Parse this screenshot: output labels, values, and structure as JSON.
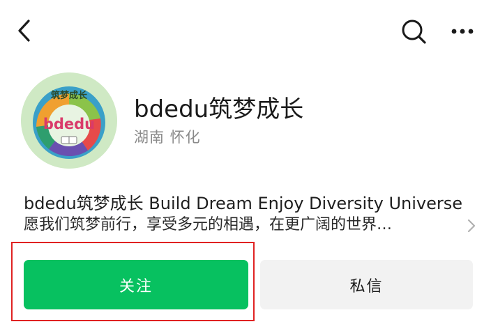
{
  "header": {
    "back_icon": "chevron-left-icon",
    "search_icon": "search-icon",
    "more_icon": "more-horizontal-icon"
  },
  "profile": {
    "avatar_logo_top": "筑梦成长",
    "avatar_logo_main": "bdedu",
    "name": "bdedu筑梦成长",
    "location": "湖南 怀化"
  },
  "bio": {
    "line1": "bdedu筑梦成长  Build Dream Enjoy Diversity Universe",
    "line2": "愿我们筑梦前行，享受多元的相遇，在更广阔的世界…"
  },
  "actions": {
    "follow_label": "关注",
    "message_label": "私信"
  },
  "colors": {
    "follow_green": "#07c160",
    "highlight_red": "#e02222",
    "secondary_gray": "#f2f2f2"
  }
}
